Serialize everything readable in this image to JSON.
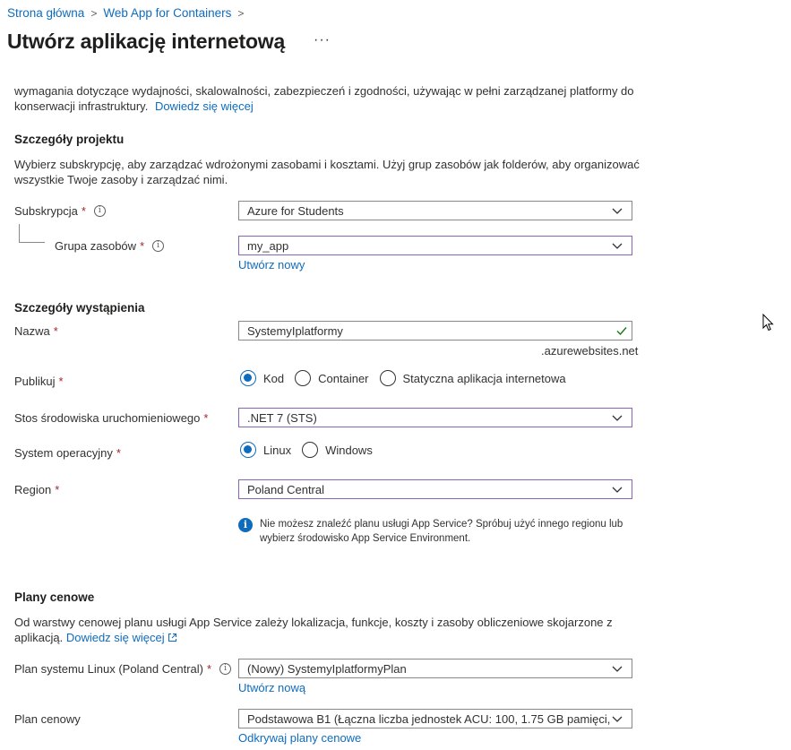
{
  "breadcrumb": {
    "items": [
      "Strona główna",
      "Web App for Containers"
    ]
  },
  "page": {
    "title": "Utwórz aplikację internetową",
    "more": "···"
  },
  "intro": {
    "text": "wymagania dotyczące wydajności, skalowalności, zabezpieczeń i zgodności, używając w pełni zarządzanej platformy do konserwacji infrastruktury.",
    "link": "Dowiedz się więcej"
  },
  "project": {
    "heading": "Szczegóły projektu",
    "description": "Wybierz subskrypcję, aby zarządzać wdrożonymi zasobami i kosztami. Użyj grup zasobów jak folderów, aby organizować wszystkie Twoje zasoby i zarządzać nimi.",
    "subscription": {
      "label": "Subskrypcja",
      "value": "Azure for Students"
    },
    "resource_group": {
      "label": "Grupa zasobów",
      "value": "my_app",
      "create_link": "Utwórz nowy"
    }
  },
  "instance": {
    "heading": "Szczegóły wystąpienia",
    "name": {
      "label": "Nazwa",
      "value": "SystemyIplatformy",
      "suffix": ".azurewebsites.net"
    },
    "publish": {
      "label": "Publikuj",
      "options": [
        "Kod",
        "Container",
        "Statyczna aplikacja internetowa"
      ],
      "selected": "Kod"
    },
    "runtime": {
      "label": "Stos środowiska uruchomieniowego",
      "value": ".NET 7 (STS)"
    },
    "os": {
      "label": "System operacyjny",
      "options": [
        "Linux",
        "Windows"
      ],
      "selected": "Linux"
    },
    "region": {
      "label": "Region",
      "value": "Poland Central"
    },
    "info": "Nie możesz znaleźć planu usługi App Service? Spróbuj użyć innego regionu lub wybierz środowisko App Service Environment."
  },
  "pricing": {
    "heading": "Plany cenowe",
    "description": "Od warstwy cenowej planu usługi App Service zależy lokalizacja, funkcje, koszty i zasoby obliczeniowe skojarzone z aplikacją.",
    "link": "Dowiedz się więcej",
    "linux_plan": {
      "label": "Plan systemu Linux (Poland Central)",
      "value": "(Nowy) SystemyIplatformyPlan",
      "create_link": "Utwórz nową"
    },
    "price_plan": {
      "label": "Plan cenowy",
      "value": "Podstawowa B1 (Łączna liczba jednostek ACU: 100, 1.75 GB pamięci, ...",
      "explore_link": "Odkrywaj plany cenowe"
    }
  },
  "colors": {
    "accent": "#0f6cbd",
    "required": "#a4262c",
    "focus_border": "#8764b8",
    "valid": "#107c10"
  }
}
